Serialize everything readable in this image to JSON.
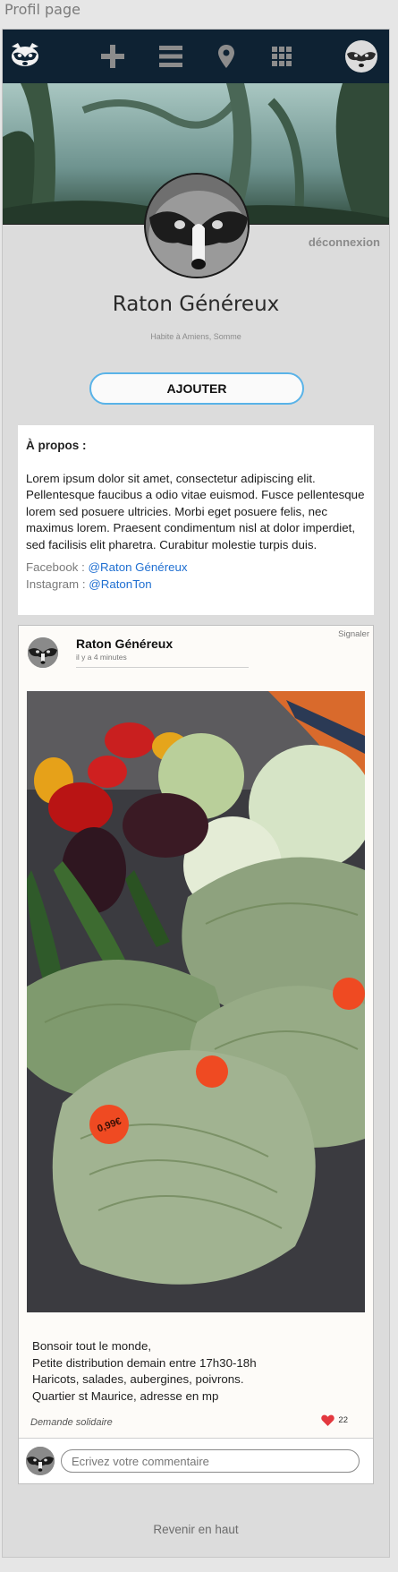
{
  "page_label": "Profil page",
  "nav": {
    "items": [
      "logo-raccoon",
      "plus-icon",
      "list-icon",
      "location-pin-icon",
      "grid-icon",
      "profile-avatar"
    ],
    "background": "#0e2233"
  },
  "profile": {
    "logout_label": "déconnexion",
    "name": "Raton Généreux",
    "location": "Habite à Amiens, Somme",
    "add_button_label": "AJOUTER"
  },
  "about": {
    "title": "À propos :",
    "text": "Lorem ipsum dolor sit amet, consectetur adipiscing elit. Pellentesque faucibus a odio vitae euismod. Fusce pellentesque lorem sed posuere ultricies. Morbi eget posuere felis, nec maximus lorem. Praesent condimentum nisl at dolor imperdiet, sed facilisis elit pharetra. Curabitur molestie turpis duis.",
    "facebook_label": "Facebook :",
    "facebook_handle": "@Raton Généreux",
    "instagram_label": "Instagram :",
    "instagram_handle": "@RatonTon"
  },
  "post": {
    "report_label": "Signaler",
    "author": "Raton Généreux",
    "time": "il y a 4 minutes",
    "lines": [
      "Bonsoir tout le monde,",
      "Petite distribution demain entre 17h30-18h",
      "Haricots, salades, aubergines, poivrons.",
      "Quartier st Maurice, adresse en mp"
    ],
    "tag": "Demande solidaire",
    "likes": "22",
    "price_sticker": "0,99€",
    "comment_placeholder": "Ecrivez votre commentaire"
  },
  "footer": {
    "back_to_top": "Revenir en haut"
  },
  "colors": {
    "accent_button_border": "#59b3e8",
    "link": "#1f6fd1",
    "heart": "#e3383f"
  }
}
